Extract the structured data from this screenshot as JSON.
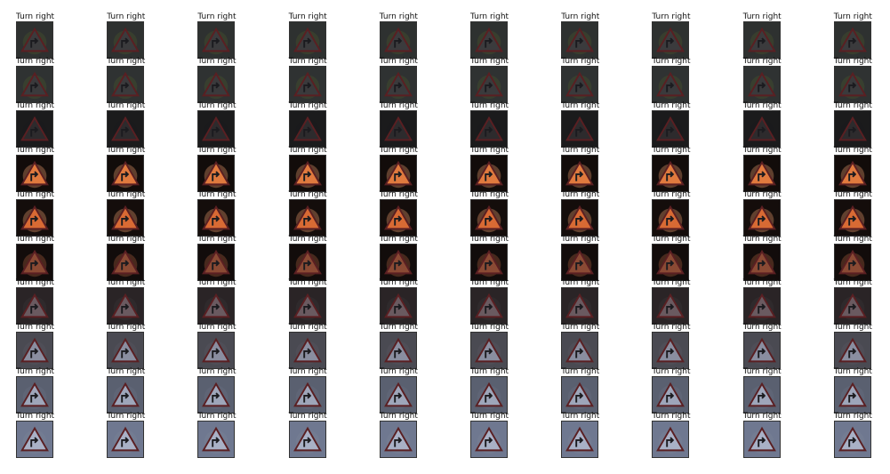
{
  "figure": {
    "rows": 10,
    "cols": 10,
    "label": "Turn right"
  },
  "rows": [
    {
      "bg": "#2e3130",
      "sign": "#3b3b3d",
      "glow": "#4a5a2a"
    },
    {
      "bg": "#2f3232",
      "sign": "#3a3a3c",
      "glow": "#4a5a2a"
    },
    {
      "bg": "#1b1b1c",
      "sign": "#2d2b2d",
      "glow": "#1b1b1c"
    },
    {
      "bg": "#120c0a",
      "sign": "#e07a3e",
      "glow": "#f0a070"
    },
    {
      "bg": "#140d0b",
      "sign": "#d86a34",
      "glow": "#f0a070"
    },
    {
      "bg": "#120c0b",
      "sign": "#8a4a34",
      "glow": "#b06040"
    },
    {
      "bg": "#2a2426",
      "sign": "#6a5a60",
      "glow": "#3a3638"
    },
    {
      "bg": "#4a4a52",
      "sign": "#8a8ea0",
      "glow": "#5a5660"
    },
    {
      "bg": "#5a6070",
      "sign": "#9ea6ba",
      "glow": "#6a7080"
    },
    {
      "bg": "#6f7890",
      "sign": "#a9b1c6",
      "glow": "#7a8398"
    }
  ]
}
